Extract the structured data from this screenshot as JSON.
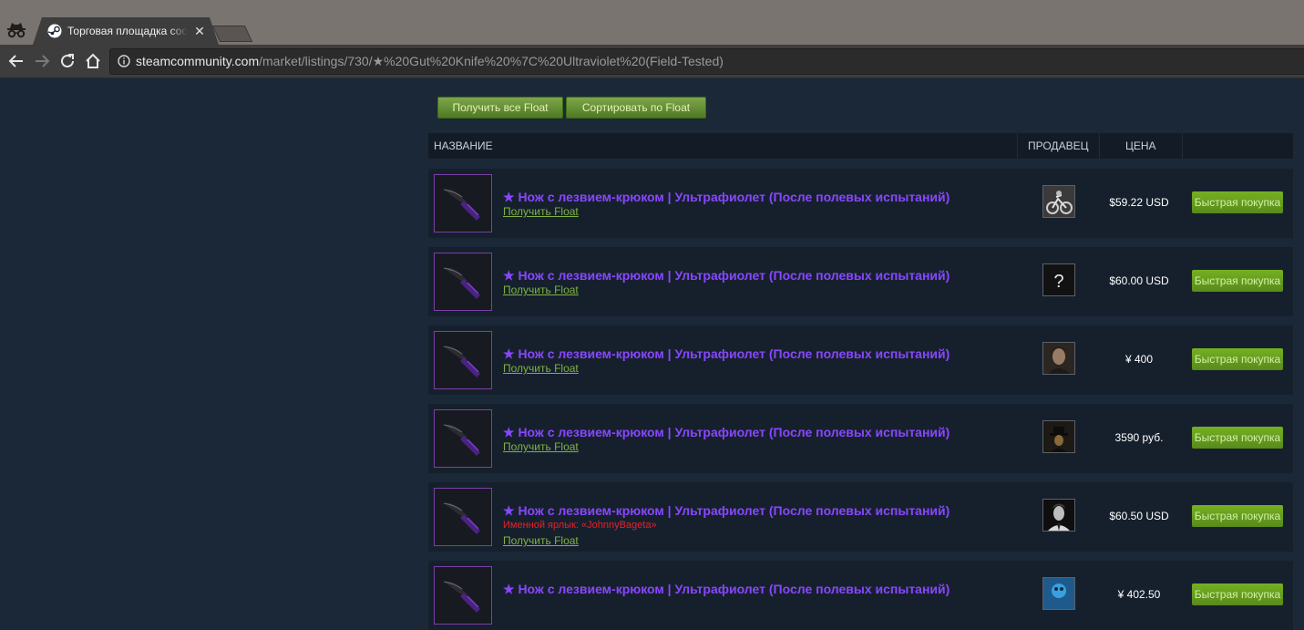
{
  "browser": {
    "tab_title": "Торговая площадка соо",
    "url_host": "steamcommunity.com",
    "url_path": "/market/listings/730/★%20Gut%20Knife%20%7C%20Ultraviolet%20(Field-Tested)"
  },
  "float_buttons": {
    "get_all": "Получить все Float",
    "sort": "Сортировать по Float"
  },
  "table": {
    "headers": {
      "name": "НАЗВАНИЕ",
      "seller": "ПРОДАВЕЦ",
      "price": "ЦЕНА"
    },
    "rows": [
      {
        "name": "★ Нож с лезвием-крюком | Ультрафиолет (После полевых испытаний)",
        "name_tag": "",
        "float_link": "Получить Float",
        "avatar": "biker-avatar",
        "price": "$59.22 USD",
        "buy": "Быстрая покупка"
      },
      {
        "name": "★ Нож с лезвием-крюком | Ультрафиолет (После полевых испытаний)",
        "name_tag": "",
        "float_link": "Получить Float",
        "avatar": "question-mark-avatar",
        "price": "$60.00 USD",
        "buy": "Быстрая покупка"
      },
      {
        "name": "★ Нож с лезвием-крюком | Ультрафиолет (После полевых испытаний)",
        "name_tag": "",
        "float_link": "Получить Float",
        "avatar": "man-portrait-avatar",
        "price": "¥ 400",
        "buy": "Быстрая покупка"
      },
      {
        "name": "★ Нож с лезвием-крюком | Ультрафиолет (После полевых испытаний)",
        "name_tag": "",
        "float_link": "Получить Float",
        "avatar": "gentleman-hat-avatar",
        "price": "3590 руб.",
        "buy": "Быстрая покупка"
      },
      {
        "name": "★ Нож с лезвием-крюком | Ультрафиолет (После полевых испытаний)",
        "name_tag": "Именной ярлык: «JohnnyBageta»",
        "float_link": "Получить Float",
        "avatar": "bw-portrait-avatar",
        "price": "$60.50 USD",
        "buy": "Быстрая покупка"
      },
      {
        "name": "★ Нож с лезвием-крюком | Ультрафиолет (После полевых испытаний)",
        "name_tag": "",
        "float_link": "",
        "avatar": "blue-character-avatar",
        "price": "¥ 402.50",
        "buy": "Быстрая покупка"
      }
    ]
  },
  "colors": {
    "page_bg": "#1b2838",
    "row_bg": "#16202d",
    "item_name": "#8847ff",
    "float_link": "#7fb242",
    "name_tag": "#e8202a",
    "buy_button": "#75b022"
  }
}
